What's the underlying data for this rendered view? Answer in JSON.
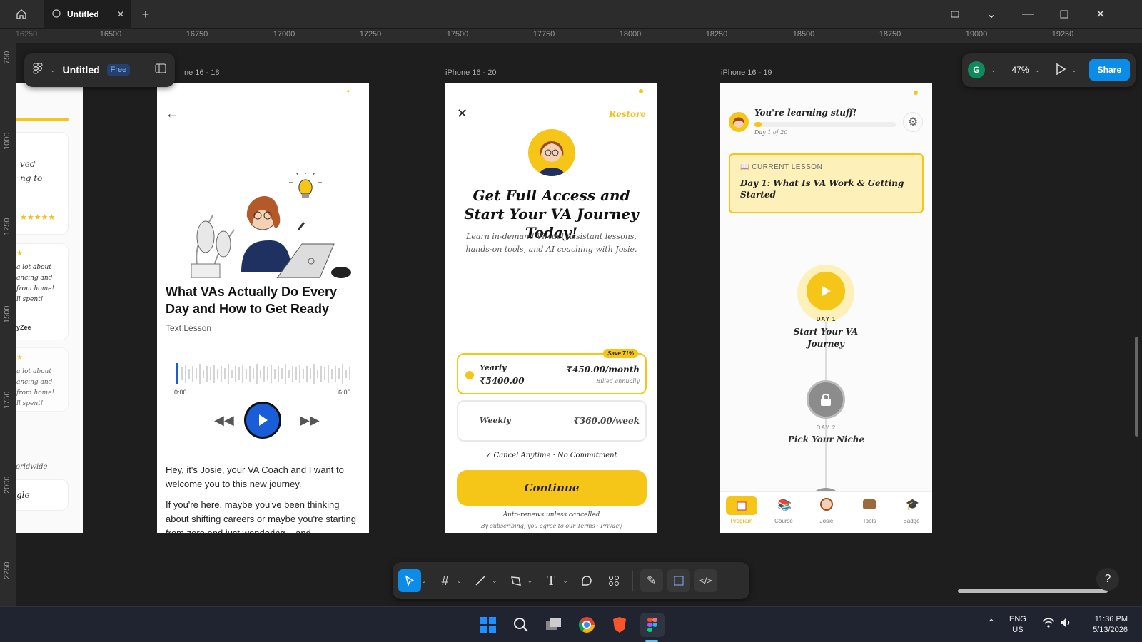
{
  "window": {
    "tab_title": "Untitled"
  },
  "ruler": {
    "h": [
      "16250",
      "16500",
      "16750",
      "17000",
      "17250",
      "17500",
      "17750",
      "18000",
      "18250",
      "18500",
      "18750",
      "19000",
      "19250"
    ],
    "v": [
      "750",
      "1000",
      "1250",
      "1500",
      "1750",
      "2000",
      "2250"
    ]
  },
  "file_panel": {
    "name": "Untitled",
    "badge": "Free"
  },
  "right_panel": {
    "avatar": "G",
    "zoom": "47%",
    "share": "Share"
  },
  "frames": {
    "f18": {
      "label": "ne 16 - 18",
      "title": "What VAs Actually Do Every Day and How to Get Ready",
      "subtitle": "Text Lesson",
      "time_start": "0:00",
      "time_end": "6:00",
      "para1": "Hey, it's Josie, your VA Coach and I want to welcome you to this new journey.",
      "para2": "If you're here, maybe you've been thinking about shifting careers or maybe you're starting from zero and just wondering... and"
    },
    "f20": {
      "label": "iPhone 16 - 20",
      "restore": "Restore",
      "heading": "Get Full Access and Start Your VA Journey Today!",
      "sub": "Learn in-demand Virtual Assistant lessons, hands-on tools, and AI coaching with Josie.",
      "save_badge": "Save 71%",
      "yearly_name": "Yearly",
      "yearly_total": "₹5400.00",
      "yearly_price": "₹450.00/month",
      "yearly_note": "Billed annually",
      "weekly_name": "Weekly",
      "weekly_price": "₹360.00/week",
      "cancel_note": "Cancel Anytime · No Commitment",
      "continue": "Continue",
      "auto_renew": "Auto-renews unless cancelled",
      "legal_prefix": "By subscribing, you agree to our",
      "terms": "Terms",
      "privacy": "Privacy"
    },
    "f19": {
      "label": "iPhone 16 - 19",
      "learning": "You're learning stuff!",
      "day_of": "Day 1 of 20",
      "progress": 0.04,
      "current_label": "CURRENT LESSON",
      "current_title": "Day 1: What Is VA Work & Getting Started",
      "day1_tag": "DAY 1",
      "day1_title": "Start Your VA Journey",
      "day2_tag": "DAY 2",
      "day2_title": "Pick Your Niche",
      "nav": [
        "Program",
        "Course",
        "Josie",
        "Tools",
        "Badge"
      ]
    },
    "left": {
      "t1": "ved",
      "t2": "ng to",
      "stars": "★★★★★",
      "t3a": "a lot about",
      "t3b": "ancing and",
      "t3c": "from home!",
      "t3d": "ll spent!",
      "author": "yZee",
      "t4a": "a lot about",
      "t4b": "ancing and",
      "t4c": "from home!",
      "t4d": "ll spent!",
      "worldwide": "orldwide",
      "btn": "gle"
    }
  },
  "taskbar": {
    "lang1": "ENG",
    "lang2": "US",
    "time": "11:36 PM",
    "date": "5/13/2026"
  },
  "colors": {
    "accent": "#0c8ce9",
    "brand_yellow": "#f5c518"
  }
}
